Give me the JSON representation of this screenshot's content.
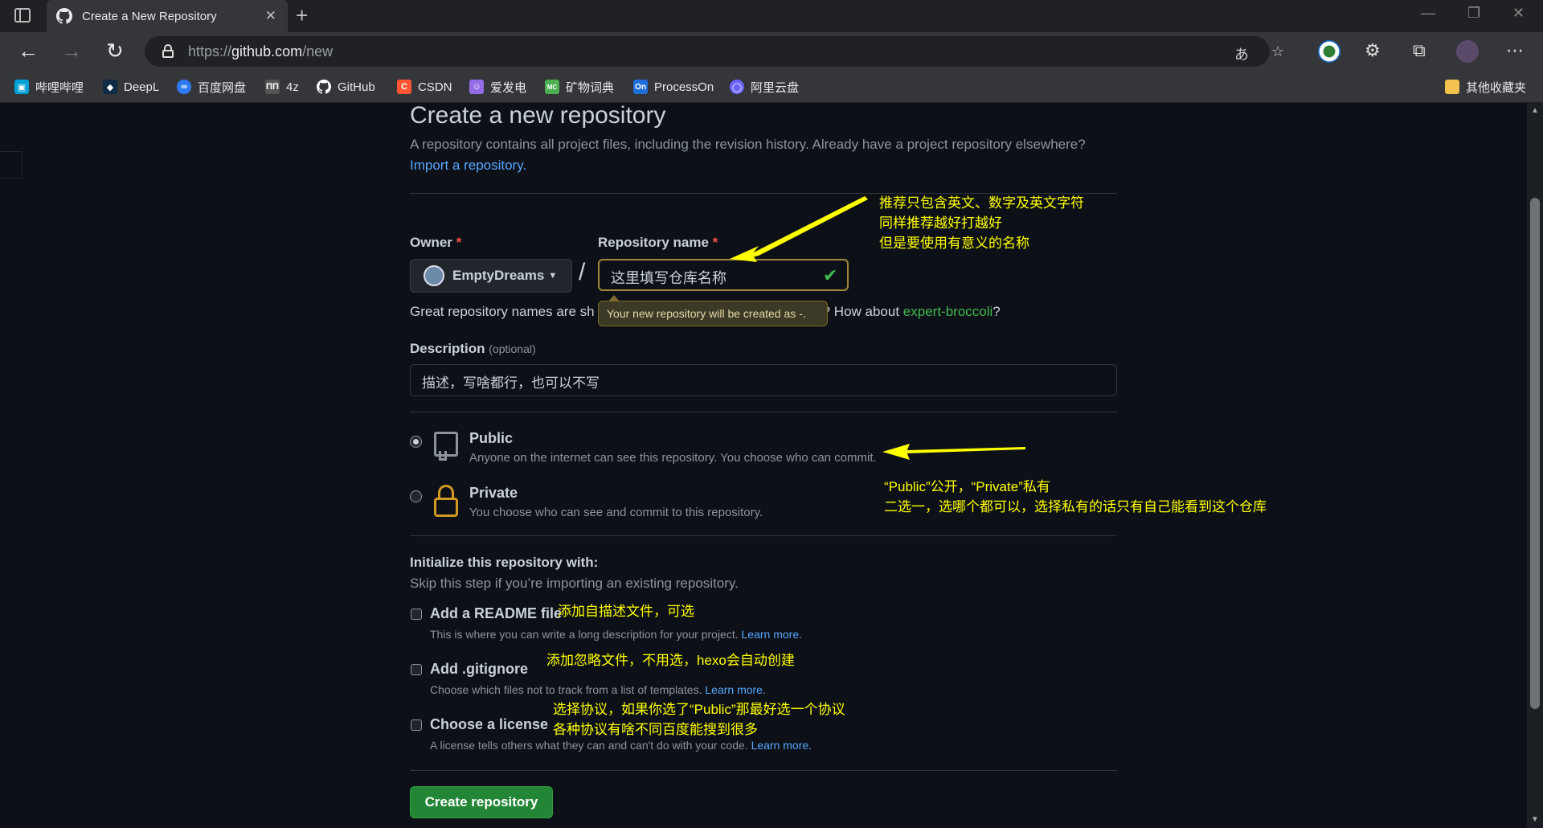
{
  "browser": {
    "tab_title": "Create a New Repository",
    "url_prefix": "https://",
    "url_host": "github.com",
    "url_path": "/new",
    "bookmarks": [
      {
        "label": "哔哩哔哩",
        "color": "#00a1d6"
      },
      {
        "label": "DeepL",
        "color": "#0f2b46"
      },
      {
        "label": "百度网盘",
        "color": "#2b7cf6"
      },
      {
        "label": "4z",
        "color": "#555555"
      },
      {
        "label": "GitHub",
        "color": "#ffffff"
      },
      {
        "label": "CSDN",
        "color": "#fc5531"
      },
      {
        "label": "爱发电",
        "color": "#946ce6"
      },
      {
        "label": "矿物词典",
        "color": "#4caf50"
      },
      {
        "label": "ProcessOn",
        "color": "#1e6fd9"
      },
      {
        "label": "阿里云盘",
        "color": "#6c63ff"
      }
    ],
    "other_bookmarks": "其他收藏夹",
    "bookmark_icon_text": {
      "csdn": "C",
      "mc": "MC",
      "on": "On",
      "fourz": "ΠΠ"
    }
  },
  "page": {
    "title": "Create a new repository",
    "subtitle": "A repository contains all project files, including the revision history. Already have a project repository elsewhere?",
    "import_link": "Import a repository.",
    "owner_label": "Owner",
    "required_mark": "*",
    "owner_value": "EmptyDreams",
    "repo_label": "Repository name",
    "repo_value": "这里填写仓库名称",
    "slash": "/",
    "hint_prefix": "Great repository names are sh",
    "hint_mid": "? How about ",
    "hint_suggestion": "expert-broccoli",
    "hint_suffix": "?",
    "tooltip": "Your new repository will be created as -.",
    "description_label": "Description",
    "description_optional": "(optional)",
    "description_value": "描述，写啥都行，也可以不写",
    "public_title": "Public",
    "public_desc": "Anyone on the internet can see this repository. You choose who can commit.",
    "private_title": "Private",
    "private_desc": "You choose who can see and commit to this repository.",
    "init_title": "Initialize this repository with:",
    "init_sub": "Skip this step if you’re importing an existing repository.",
    "readme_title": "Add a README file",
    "readme_desc": "This is where you can write a long description for your project.",
    "gitignore_title": "Add .gitignore",
    "gitignore_desc": "Choose which files not to track from a list of templates.",
    "license_title": "Choose a license",
    "license_desc": "A license tells others what they can and can't do with your code.",
    "learn_more": "Learn more.",
    "create_button": "Create repository",
    "public_selected": true
  },
  "annotations": {
    "repo_note_1": "推荐只包含英文、数字及英文字符",
    "repo_note_2": "同样推荐越好打越好",
    "repo_note_3": "但是要使用有意义的名称",
    "vis_note_1": "“Public”公开，“Private”私有",
    "vis_note_2": "二选一，选哪个都可以，选择私有的话只有自己能看到这个仓库",
    "readme_note": "添加自描述文件，可选",
    "gitignore_note": "添加忽略文件，不用选，hexo会自动创建",
    "license_note_1": "选择协议，如果你选了“Public”那最好选一个协议",
    "license_note_2": "各种协议有啥不同百度能搜到很多",
    "color": "#ffff00"
  }
}
